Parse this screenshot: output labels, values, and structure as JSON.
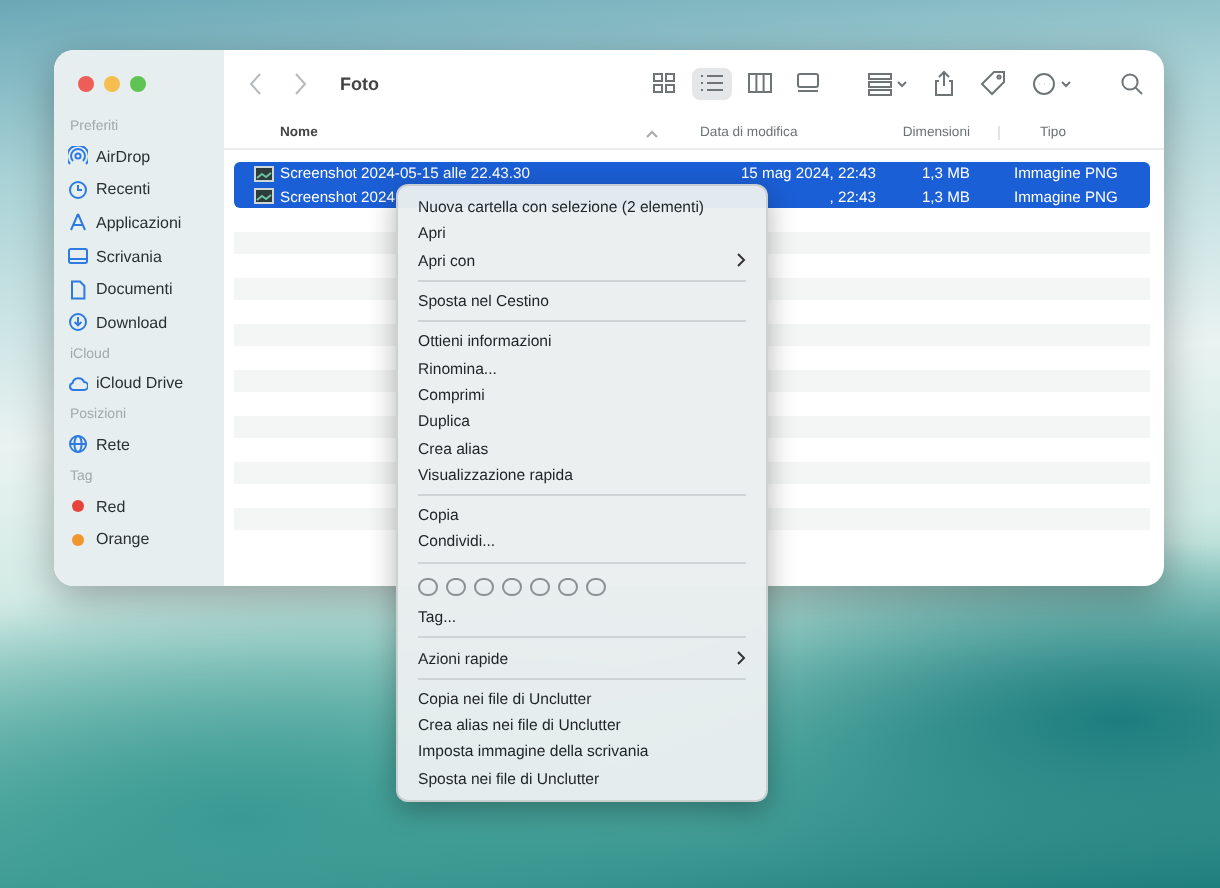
{
  "window": {
    "title": "Foto"
  },
  "toolbar": {
    "view_buttons": [
      {
        "selected": false
      },
      {
        "selected": true
      },
      {
        "selected": false
      },
      {
        "selected": false
      }
    ]
  },
  "sidebar": {
    "sections": [
      {
        "title": "Preferiti",
        "items": [
          {
            "label": "AirDrop"
          },
          {
            "label": "Recenti"
          },
          {
            "label": "Applicazioni"
          },
          {
            "label": "Scrivania"
          },
          {
            "label": "Documenti"
          },
          {
            "label": "Download"
          }
        ]
      },
      {
        "title": "iCloud",
        "items": [
          {
            "label": "iCloud Drive"
          }
        ]
      },
      {
        "title": "Posizioni",
        "items": [
          {
            "label": "Rete"
          }
        ]
      },
      {
        "title": "Tag",
        "items": [
          {
            "label": "Red",
            "color": "#e5443b"
          },
          {
            "label": "Orange",
            "color": "#f0962a"
          }
        ]
      }
    ]
  },
  "table": {
    "columns": [
      "Nome",
      "Data di modifica",
      "Dimensioni",
      "Tipo"
    ],
    "rows": [
      {
        "name": "Screenshot 2024-05-15 alle 22.43.30",
        "date": "15 mag 2024, 22:43",
        "size": "1,3 MB",
        "type": "Immagine PNG",
        "selected": true
      },
      {
        "name": "Screenshot 2024",
        "date": ", 22:43",
        "size": "1,3 MB",
        "type": "Immagine PNG",
        "selected": true
      }
    ]
  },
  "context_menu": {
    "items": [
      {
        "kind": "item",
        "label": "Nuova cartella con selezione (2 elementi)",
        "submenu": false
      },
      {
        "kind": "item",
        "label": "Apri",
        "submenu": false
      },
      {
        "kind": "item",
        "label": "Apri con",
        "submenu": true
      },
      {
        "kind": "separator"
      },
      {
        "kind": "item",
        "label": "Sposta nel Cestino",
        "submenu": false
      },
      {
        "kind": "separator"
      },
      {
        "kind": "item",
        "label": "Ottieni informazioni",
        "submenu": false
      },
      {
        "kind": "item",
        "label": "Rinomina...",
        "submenu": false
      },
      {
        "kind": "item",
        "label": "Comprimi",
        "submenu": false
      },
      {
        "kind": "item",
        "label": "Duplica",
        "submenu": false
      },
      {
        "kind": "item",
        "label": "Crea alias",
        "submenu": false
      },
      {
        "kind": "item",
        "label": "Visualizzazione rapida",
        "submenu": false
      },
      {
        "kind": "separator"
      },
      {
        "kind": "item",
        "label": "Copia",
        "submenu": false
      },
      {
        "kind": "item",
        "label": "Condividi...",
        "submenu": false
      },
      {
        "kind": "separator"
      },
      {
        "kind": "tags"
      },
      {
        "kind": "item",
        "label": "Tag...",
        "submenu": false
      },
      {
        "kind": "separator"
      },
      {
        "kind": "item",
        "label": "Azioni rapide",
        "submenu": true
      },
      {
        "kind": "separator"
      },
      {
        "kind": "item",
        "label": "Copia nei file di Unclutter",
        "submenu": false
      },
      {
        "kind": "item",
        "label": "Crea alias nei file di Unclutter",
        "submenu": false
      },
      {
        "kind": "item",
        "label": "Imposta immagine della scrivania",
        "submenu": false
      },
      {
        "kind": "item",
        "label": "Sposta nei file di Unclutter",
        "submenu": false
      }
    ]
  }
}
